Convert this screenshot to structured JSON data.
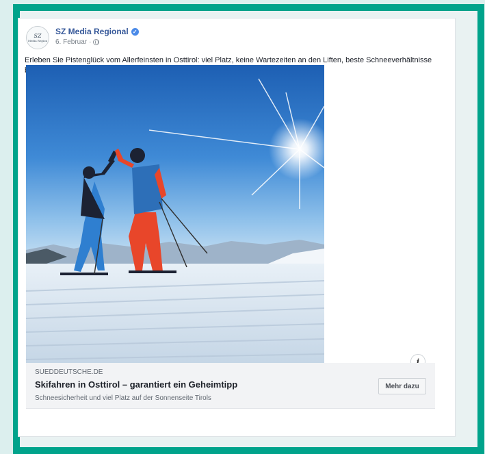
{
  "post": {
    "page_name": "SZ Media Regional",
    "avatar_text_top": "SZ",
    "avatar_text_bottom": "Media Region",
    "date": "6. Februar",
    "separator": "·",
    "text": "Erleben Sie Pistenglück vom Allerfeinsten in Osttirol: viel Platz, keine Wartezeiten an den Liften, beste Schneeverhältnisse bis Saisonende und unzählige Sonnenstunden."
  },
  "link_preview": {
    "domain": "SUEDDEUTSCHE.DE",
    "headline": "Skifahren in Osttirol – garantiert ein Geheimtipp",
    "description": "Schneesicherheit und viel Platz auf der Sonnenseite Tirols",
    "cta_label": "Mehr dazu",
    "info_glyph": "i"
  },
  "icons": {
    "verified": "verified-badge-icon",
    "audience": "globe-icon",
    "info": "info-icon"
  },
  "colors": {
    "frame_border": "#00a38b",
    "background": "#dcefee",
    "page_name": "#365899",
    "verified_badge": "#4a8ae8"
  }
}
